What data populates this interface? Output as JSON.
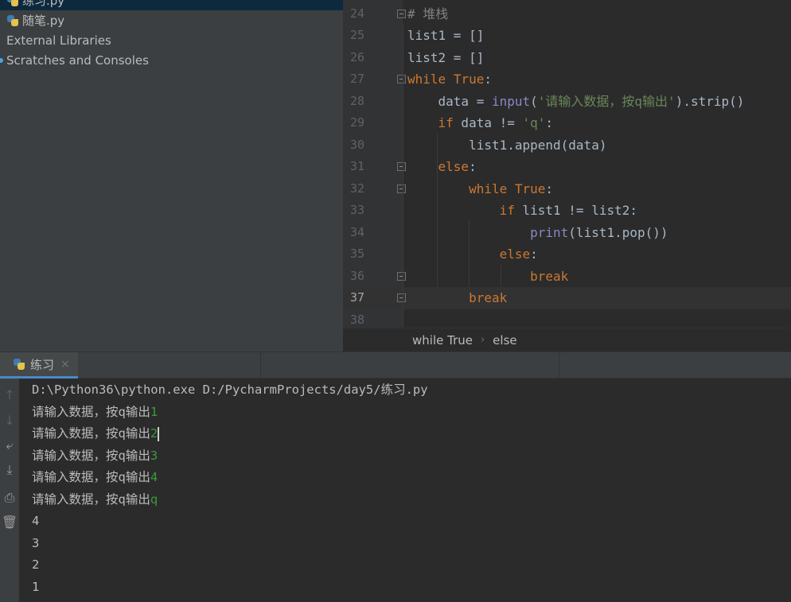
{
  "project_tree": {
    "items": [
      {
        "label": "练习.py",
        "icon": "python-file-icon",
        "selected": true
      },
      {
        "label": "随笔.py",
        "icon": "python-file-icon",
        "selected": false
      },
      {
        "label": "External Libraries",
        "icon": "library-icon",
        "selected": false
      },
      {
        "label": "Scratches and Consoles",
        "icon": "scratches-icon",
        "selected": false
      }
    ]
  },
  "editor": {
    "current_line": 37,
    "lines": [
      {
        "number": "24",
        "tokens": [
          {
            "t": "# 堆栈",
            "c": "cm"
          }
        ]
      },
      {
        "number": "25",
        "tokens": [
          {
            "t": "list1 = []",
            "c": ""
          }
        ]
      },
      {
        "number": "26",
        "tokens": [
          {
            "t": "list2 = []",
            "c": ""
          }
        ]
      },
      {
        "number": "27",
        "tokens": [
          {
            "t": "while",
            "c": "kw"
          },
          {
            "t": " ",
            "c": ""
          },
          {
            "t": "True",
            "c": "kw"
          },
          {
            "t": ":",
            "c": ""
          }
        ]
      },
      {
        "number": "28",
        "tokens": [
          {
            "t": "    data = ",
            "c": ""
          },
          {
            "t": "input",
            "c": "bi"
          },
          {
            "t": "(",
            "c": ""
          },
          {
            "t": "'请输入数据，按q输出'",
            "c": "str"
          },
          {
            "t": ").strip()",
            "c": ""
          }
        ]
      },
      {
        "number": "29",
        "tokens": [
          {
            "t": "    ",
            "c": ""
          },
          {
            "t": "if",
            "c": "kw"
          },
          {
            "t": " data != ",
            "c": ""
          },
          {
            "t": "'q'",
            "c": "str"
          },
          {
            "t": ":",
            "c": ""
          }
        ]
      },
      {
        "number": "30",
        "tokens": [
          {
            "t": "        list1.append(data)",
            "c": ""
          }
        ]
      },
      {
        "number": "31",
        "tokens": [
          {
            "t": "    ",
            "c": ""
          },
          {
            "t": "else",
            "c": "kw"
          },
          {
            "t": ":",
            "c": ""
          }
        ]
      },
      {
        "number": "32",
        "tokens": [
          {
            "t": "        ",
            "c": ""
          },
          {
            "t": "while",
            "c": "kw"
          },
          {
            "t": " ",
            "c": ""
          },
          {
            "t": "True",
            "c": "kw"
          },
          {
            "t": ":",
            "c": ""
          }
        ]
      },
      {
        "number": "33",
        "tokens": [
          {
            "t": "            ",
            "c": ""
          },
          {
            "t": "if",
            "c": "kw"
          },
          {
            "t": " list1 != list2:",
            "c": ""
          }
        ]
      },
      {
        "number": "34",
        "tokens": [
          {
            "t": "                ",
            "c": ""
          },
          {
            "t": "print",
            "c": "bi"
          },
          {
            "t": "(list1.pop())",
            "c": ""
          }
        ]
      },
      {
        "number": "35",
        "tokens": [
          {
            "t": "            ",
            "c": ""
          },
          {
            "t": "else",
            "c": "kw"
          },
          {
            "t": ":",
            "c": ""
          }
        ]
      },
      {
        "number": "36",
        "tokens": [
          {
            "t": "                ",
            "c": ""
          },
          {
            "t": "break",
            "c": "kw"
          }
        ]
      },
      {
        "number": "37",
        "tokens": [
          {
            "t": "        ",
            "c": ""
          },
          {
            "t": "break",
            "c": "kw"
          }
        ]
      },
      {
        "number": "38",
        "tokens": []
      }
    ],
    "breadcrumb": [
      "while True",
      "else"
    ]
  },
  "run_panel": {
    "tab_label": "练习",
    "tab_close": "×",
    "console": [
      {
        "text": "D:\\Python36\\python.exe D:/PycharmProjects/day5/练习.py",
        "input": ""
      },
      {
        "text": "请输入数据，按q输出",
        "input": "1"
      },
      {
        "text": "请输入数据，按q输出",
        "input": "2",
        "caret": true
      },
      {
        "text": "请输入数据，按q输出",
        "input": "3"
      },
      {
        "text": "请输入数据，按q输出",
        "input": "4"
      },
      {
        "text": "请输入数据，按q输出",
        "input": "q"
      },
      {
        "text": "4",
        "input": ""
      },
      {
        "text": "3",
        "input": ""
      },
      {
        "text": "2",
        "input": ""
      },
      {
        "text": "1",
        "input": ""
      }
    ],
    "toolbar": [
      {
        "name": "up-arrow-icon",
        "glyph": "↑",
        "disabled": true
      },
      {
        "name": "down-arrow-icon",
        "glyph": "↓",
        "disabled": true
      },
      {
        "name": "soft-wrap-icon",
        "glyph": "⤶",
        "disabled": false
      },
      {
        "name": "scroll-to-end-icon",
        "glyph": "⤓",
        "disabled": false
      },
      {
        "name": "print-icon",
        "glyph": "⎙",
        "disabled": false
      },
      {
        "name": "trash-icon",
        "glyph": "🗑",
        "disabled": false
      }
    ]
  },
  "colors": {
    "keyword": "#cc7832",
    "string": "#6a8759",
    "comment": "#808080",
    "builtin": "#8888c6",
    "console_input": "#3a9b3a",
    "selection": "#0d293e"
  }
}
